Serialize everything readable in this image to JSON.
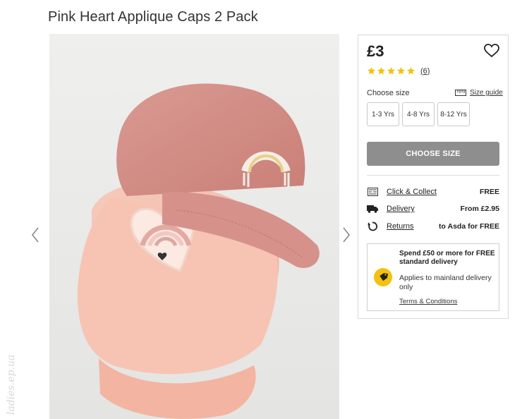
{
  "product": {
    "title": "Pink Heart Applique Caps 2 Pack",
    "image_alt": "Two stacked pink baseball caps, one with a rainbow applique and one with a heart applique"
  },
  "gallery": {
    "prev_icon": "chevron-left-icon",
    "next_icon": "chevron-right-icon"
  },
  "watermark": {
    "text": "ladies.ep.ua"
  },
  "panel": {
    "price": "£3",
    "wishlist_icon": "heart-outline-icon",
    "rating": {
      "stars": 5,
      "max": 5,
      "count_label": "(6)",
      "star_color": "#f3c20f"
    },
    "size_label": "Choose size",
    "size_guide_label": "Size guide",
    "sizes": [
      "1-3 Yrs",
      "4-8 Yrs",
      "8-12 Yrs"
    ],
    "choose_button": "CHOOSE SIZE",
    "delivery": [
      {
        "icon": "store-icon",
        "label": "Click & Collect",
        "value": "FREE"
      },
      {
        "icon": "truck-icon",
        "label": "Delivery",
        "value": "From £2.95"
      },
      {
        "icon": "returns-icon",
        "label": "Returns",
        "value": "to Asda for FREE"
      }
    ],
    "promo": {
      "headline": "Spend £50 or more for FREE standard delivery",
      "body": "Applies to mainland delivery only",
      "terms_link": "Terms & Conditions",
      "badge_icon": "tag-icon",
      "badge_color": "#f3c20f"
    }
  }
}
